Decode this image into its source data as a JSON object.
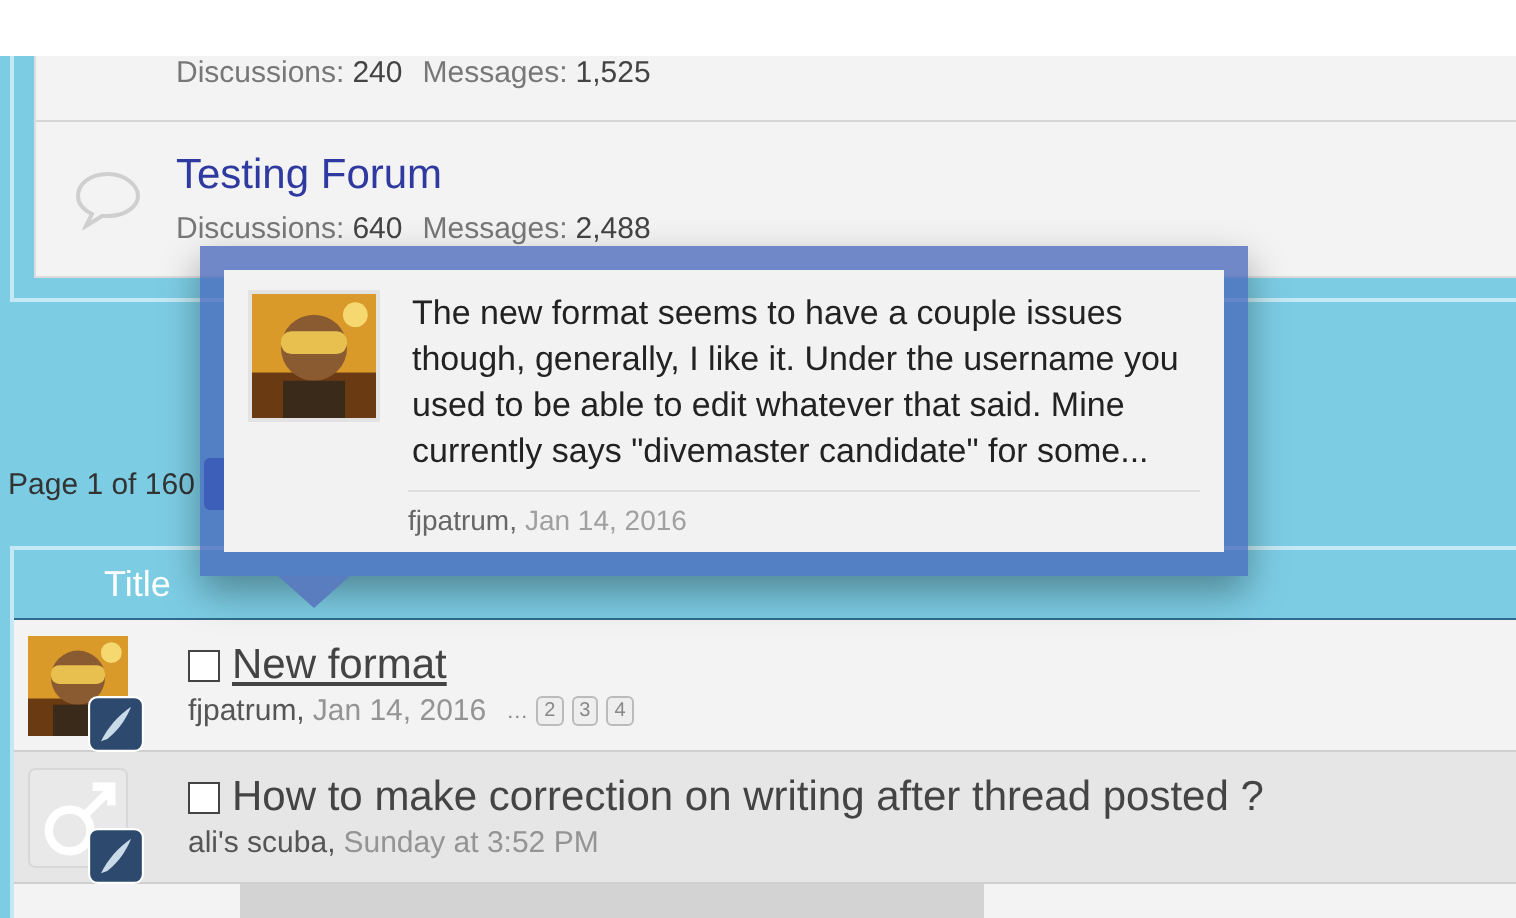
{
  "forums": [
    {
      "stats": [
        {
          "label": "Discussions:",
          "value": "240"
        },
        {
          "label": "Messages:",
          "value": "1,525"
        }
      ]
    },
    {
      "title": "Testing Forum",
      "stats": [
        {
          "label": "Discussions:",
          "value": "640"
        },
        {
          "label": "Messages:",
          "value": "2,488"
        }
      ]
    }
  ],
  "pagination": {
    "label": "Page 1 of 160"
  },
  "table": {
    "columns": [
      "Title"
    ],
    "rows": [
      {
        "title": "New format",
        "hovered": true,
        "checked": false,
        "author": "fjpatrum,",
        "date": "Jan 14, 2016",
        "ellipsis": "…",
        "pages": [
          "2",
          "3",
          "4"
        ]
      },
      {
        "title": "How to make correction on writing after thread posted ?",
        "hovered": false,
        "checked": false,
        "avatar": {
          "kind": "default"
        },
        "author": "ali's scuba,",
        "date": "Sunday at 3:52 PM",
        "ellipsis": "",
        "pages": []
      }
    ]
  },
  "tooltip": {
    "text": "The new format seems to have a couple issues though, generally, I like it. Under the username you used to be able to edit whatever that said. Mine currently says \"divemaster candidate\" for some...",
    "author": "fjpatrum,",
    "date": "Jan 14, 2016"
  }
}
